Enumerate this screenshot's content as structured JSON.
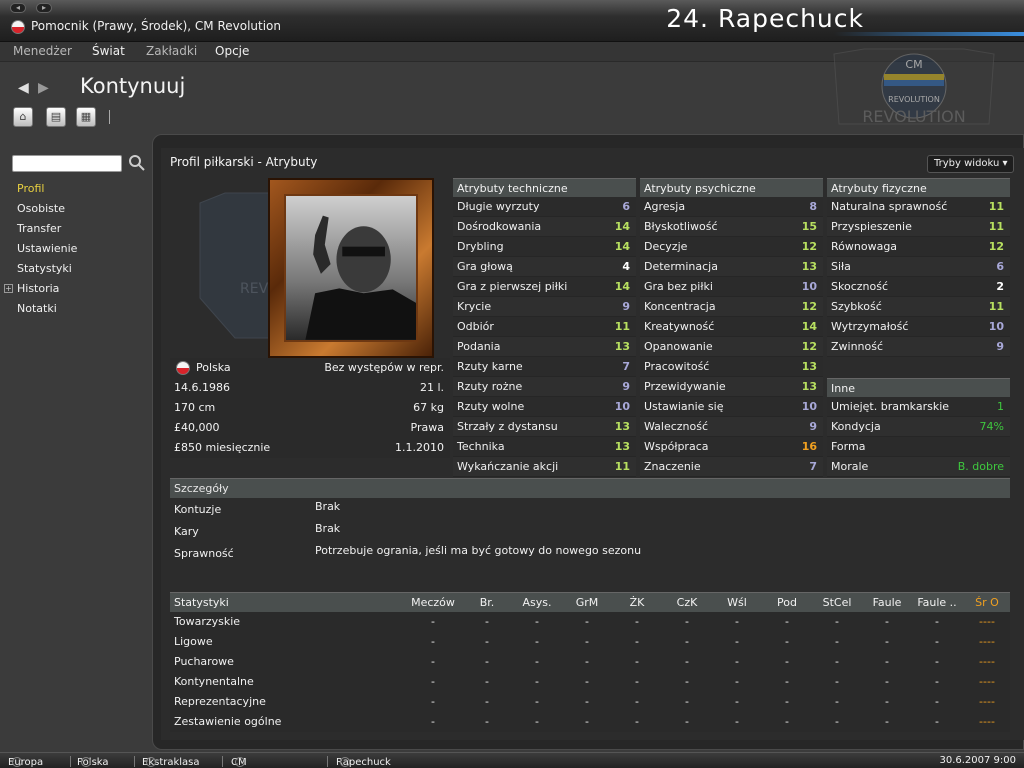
{
  "titlebar": {
    "player_position": "Pomocnik (Prawy, Środek), CM Revolution",
    "player_name": "24. Rapechuck",
    "win_buttons": [
      "◂",
      "▸"
    ]
  },
  "menu": {
    "items": [
      "Menedżer",
      "Świat",
      "Zakładki",
      "Opcje"
    ]
  },
  "nav": {
    "back": "◀",
    "forward": "▶",
    "continue_label": "Kontynuuj"
  },
  "club": {
    "crest_top_text": "CM",
    "crest_banner_text": "REVOLUTION",
    "crest_bottom_text": "REVOLUTION"
  },
  "sidebar": {
    "items": [
      {
        "label": "Profil",
        "active": true
      },
      {
        "label": "Osobiste",
        "active": false
      },
      {
        "label": "Transfer",
        "active": false
      },
      {
        "label": "Ustawienie",
        "active": false
      },
      {
        "label": "Statystyki",
        "active": false
      },
      {
        "label": "Historia",
        "active": false,
        "expandable": true
      },
      {
        "label": "Notatki",
        "active": false
      }
    ],
    "expander_symbol": "+"
  },
  "panel": {
    "title": "Profil piłkarski - Atrybuty",
    "view_mode_label": "Tryby widoku ▾"
  },
  "info": {
    "rows": [
      {
        "left": "Polska",
        "right": "Bez występów w repr."
      },
      {
        "left": "14.6.1986",
        "right": "21 l."
      },
      {
        "left": "170 cm",
        "right": "67 kg"
      },
      {
        "left": "£40,000",
        "right": "Prawa"
      },
      {
        "left": "£850 miesięcznie",
        "right": "1.1.2010"
      }
    ]
  },
  "attributes": {
    "technical": {
      "title": "Atrybuty techniczne",
      "rows": [
        {
          "name": "Długie wyrzuty",
          "value": "6"
        },
        {
          "name": "Dośrodkowania",
          "value": "14"
        },
        {
          "name": "Drybling",
          "value": "14"
        },
        {
          "name": "Gra głową",
          "value": "4"
        },
        {
          "name": "Gra z pierwszej piłki",
          "value": "14"
        },
        {
          "name": "Krycie",
          "value": "9"
        },
        {
          "name": "Odbiór",
          "value": "11"
        },
        {
          "name": "Podania",
          "value": "13"
        },
        {
          "name": "Rzuty karne",
          "value": "7"
        },
        {
          "name": "Rzuty rożne",
          "value": "9"
        },
        {
          "name": "Rzuty wolne",
          "value": "10"
        },
        {
          "name": "Strzały z dystansu",
          "value": "13"
        },
        {
          "name": "Technika",
          "value": "13"
        },
        {
          "name": "Wykańczanie akcji",
          "value": "11"
        }
      ]
    },
    "mental": {
      "title": "Atrybuty psychiczne",
      "rows": [
        {
          "name": "Agresja",
          "value": "8"
        },
        {
          "name": "Błyskotliwość",
          "value": "15"
        },
        {
          "name": "Decyzje",
          "value": "12"
        },
        {
          "name": "Determinacja",
          "value": "13"
        },
        {
          "name": "Gra bez piłki",
          "value": "10"
        },
        {
          "name": "Koncentracja",
          "value": "12"
        },
        {
          "name": "Kreatywność",
          "value": "14"
        },
        {
          "name": "Opanowanie",
          "value": "12"
        },
        {
          "name": "Pracowitość",
          "value": "13"
        },
        {
          "name": "Przewidywanie",
          "value": "13"
        },
        {
          "name": "Ustawianie się",
          "value": "10"
        },
        {
          "name": "Waleczność",
          "value": "9"
        },
        {
          "name": "Współpraca",
          "value": "16"
        },
        {
          "name": "Znaczenie",
          "value": "7"
        }
      ]
    },
    "physical": {
      "title": "Atrybuty fizyczne",
      "rows": [
        {
          "name": "Naturalna sprawność",
          "value": "11"
        },
        {
          "name": "Przyspieszenie",
          "value": "11"
        },
        {
          "name": "Równowaga",
          "value": "12"
        },
        {
          "name": "Siła",
          "value": "6"
        },
        {
          "name": "Skoczność",
          "value": "2"
        },
        {
          "name": "Szybkość",
          "value": "11"
        },
        {
          "name": "Wytrzymałość",
          "value": "10"
        },
        {
          "name": "Zwinność",
          "value": "9"
        }
      ]
    },
    "other": {
      "title": "Inne",
      "rows": [
        {
          "name": "Umiejęt. bramkarskie",
          "value": "1"
        },
        {
          "name": "Kondycja",
          "value": "74%"
        },
        {
          "name": "Forma",
          "value": ""
        },
        {
          "name": "Morale",
          "value": "B. dobre"
        }
      ]
    },
    "colors": {
      "very_low": "#ffffff",
      "low": "#a8a8d8",
      "mid": "#b8e060",
      "high": "#e8e040",
      "top": "#f0a020",
      "green": "#3ec83e"
    }
  },
  "details": {
    "title": "Szczegóły",
    "rows": [
      {
        "label": "Kontuzje",
        "value": "Brak"
      },
      {
        "label": "Kary",
        "value": "Brak"
      },
      {
        "label": "Sprawność",
        "value": "Potrzebuje ogrania, jeśli ma być gotowy do nowego sezonu"
      }
    ]
  },
  "stats": {
    "title": "Statystyki",
    "columns": [
      "Meczów",
      "Br.",
      "Asys.",
      "GrM",
      "ŻK",
      "CzK",
      "Wśl",
      "Pod",
      "StCel",
      "Faule",
      "Faule ..",
      "Śr O"
    ],
    "rows": [
      {
        "label": "Towarzyskie",
        "values": [
          "-",
          "-",
          "-",
          "-",
          "-",
          "-",
          "-",
          "-",
          "-",
          "-",
          "-",
          "----"
        ]
      },
      {
        "label": "Ligowe",
        "values": [
          "-",
          "-",
          "-",
          "-",
          "-",
          "-",
          "-",
          "-",
          "-",
          "-",
          "-",
          "----"
        ]
      },
      {
        "label": "Pucharowe",
        "values": [
          "-",
          "-",
          "-",
          "-",
          "-",
          "-",
          "-",
          "-",
          "-",
          "-",
          "-",
          "----"
        ]
      },
      {
        "label": "Kontynentalne",
        "values": [
          "-",
          "-",
          "-",
          "-",
          "-",
          "-",
          "-",
          "-",
          "-",
          "-",
          "-",
          "----"
        ]
      },
      {
        "label": "Reprezentacyjne",
        "values": [
          "-",
          "-",
          "-",
          "-",
          "-",
          "-",
          "-",
          "-",
          "-",
          "-",
          "-",
          "----"
        ]
      },
      {
        "label": "Zestawienie ogólne",
        "values": [
          "-",
          "-",
          "-",
          "-",
          "-",
          "-",
          "-",
          "-",
          "-",
          "-",
          "-",
          "----"
        ]
      }
    ],
    "rating_color": "#f0a020"
  },
  "statusbar": {
    "crumbs": [
      "Europa",
      "Polska",
      "Ekstraklasa",
      "CM Revolution",
      "Rapechuck"
    ],
    "datetime": "30.6.2007 9:00"
  }
}
